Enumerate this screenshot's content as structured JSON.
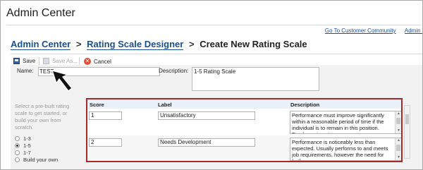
{
  "app": {
    "title": "Admin Center"
  },
  "top_links": [
    {
      "label": "Go To Customer Community"
    },
    {
      "label": "Admin Re"
    }
  ],
  "breadcrumb": {
    "items": [
      "Admin Center",
      "Rating Scale Designer"
    ],
    "separator": ">",
    "current": "Create New Rating Scale"
  },
  "toolbar": {
    "save_label": "Save",
    "save_as_label": "Save As...",
    "cancel_label": "Cancel"
  },
  "form": {
    "name_label": "Name:",
    "name_value": "TEST",
    "description_label": "Description:",
    "description_value": "1-5 Rating Scale"
  },
  "left_panel": {
    "help_text": "Select a pre-built rating scale to get started, or build your own from scratch.",
    "options": [
      {
        "label": "1-3",
        "checked": false
      },
      {
        "label": "1-5",
        "checked": true
      },
      {
        "label": "1-7",
        "checked": false
      },
      {
        "label": "Build your own",
        "checked": false
      }
    ]
  },
  "table": {
    "headers": {
      "score": "Score",
      "label": "Label",
      "description": "Description"
    },
    "rows": [
      {
        "score": "1",
        "label": "Unsatisfactory",
        "description": "Performance must improve significantly within a reasonable period of time if the individual is to remain in this position. Employee is not"
      },
      {
        "score": "2",
        "label": "Needs Development",
        "description": "Performance is noticeably less than expected. Usually performs to and meets job requirements, however the need for further"
      }
    ]
  },
  "colors": {
    "accent_link": "#1d4fa0",
    "highlight_border": "#a62a2a",
    "header_bg": "#ebf1fa"
  }
}
